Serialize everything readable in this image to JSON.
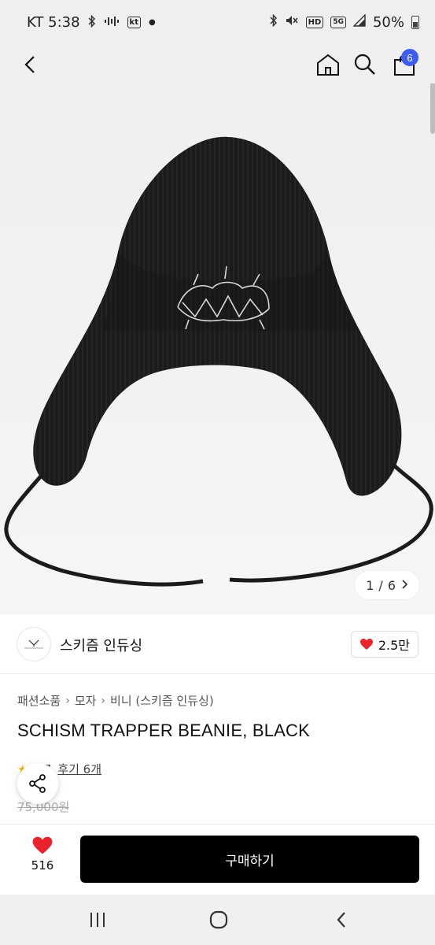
{
  "status_bar": {
    "carrier_time": "KT 5:38",
    "carrier_badge": "kt",
    "hd_badge": "HD",
    "network_badge": "5G",
    "battery": "50%"
  },
  "app_bar": {
    "cart_count": "6",
    "icons": [
      "back-arrow-icon",
      "home-icon",
      "search-icon",
      "shopping-bag-icon"
    ]
  },
  "gallery": {
    "current": "1",
    "separator": "/",
    "total": "6"
  },
  "shop": {
    "name": "스키즘 인듀싱",
    "like_count": "2.5만"
  },
  "breadcrumb": [
    "패션소품",
    "모자",
    "비니 (스키즘 인듀싱)"
  ],
  "product": {
    "title": "SCHISM TRAPPER BEANIE, BLACK",
    "rating": "4.7",
    "reviews": "후기 6개",
    "original_price": "75,000원"
  },
  "action_bar": {
    "wish_count": "516",
    "buy_label": "구매하기"
  },
  "colors": {
    "accent_blue": "#3d5cf0",
    "heart_red": "#e8232e",
    "star_yellow": "#f2b400",
    "buy_button": "#000000"
  }
}
